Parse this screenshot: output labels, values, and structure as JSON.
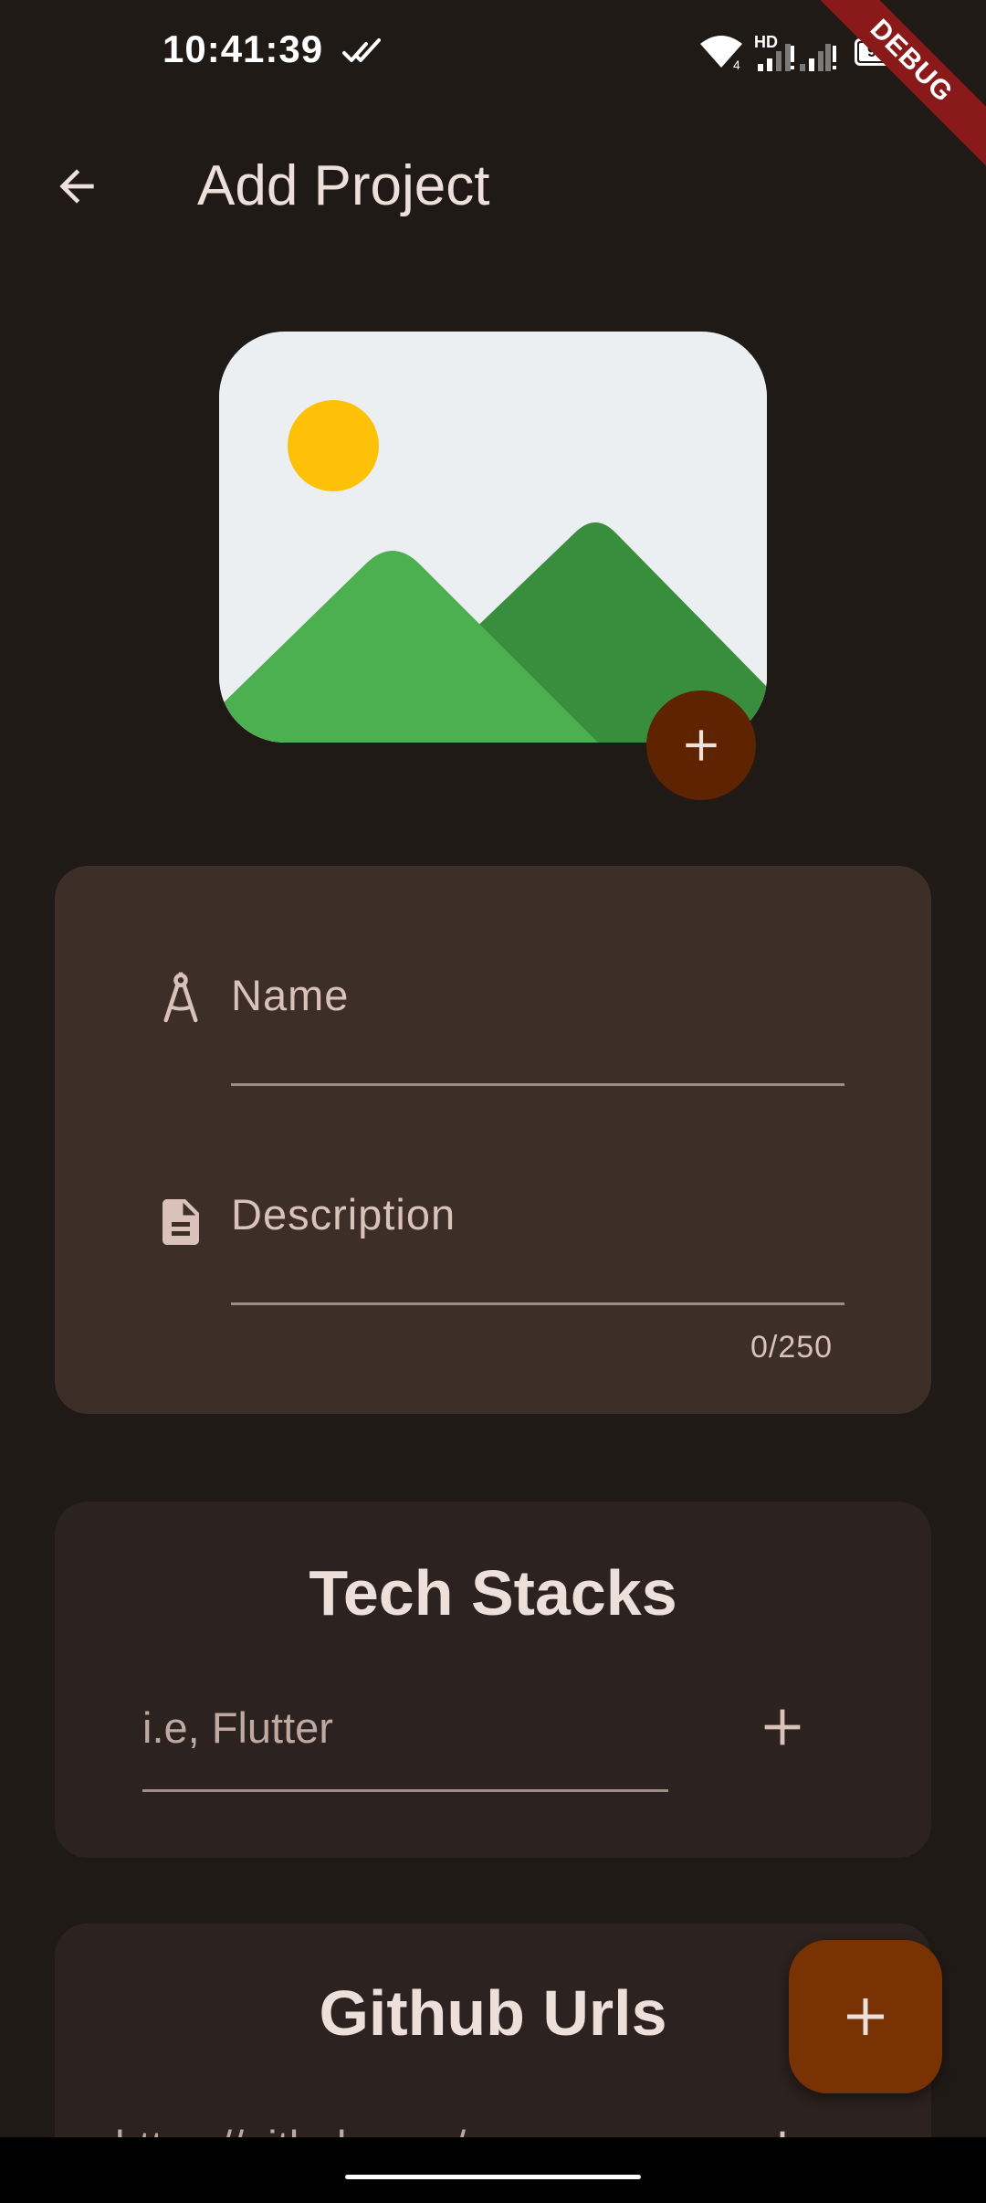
{
  "status_bar": {
    "time": "10:41:39",
    "network_label": "HD",
    "wifi_badge": "4",
    "battery": "92"
  },
  "debug_banner": "DEBUG",
  "app_bar": {
    "title": "Add Project"
  },
  "form": {
    "name_label": "Name",
    "description_label": "Description",
    "description_counter": "0/250"
  },
  "tech_stacks": {
    "title": "Tech Stacks",
    "input_hint": "i.e, Flutter"
  },
  "github_urls": {
    "title": "Github Urls",
    "input_hint": "https://github.com/..."
  },
  "colors": {
    "background": "#201a17",
    "card_primary": "#3d2e28",
    "card_secondary": "#2c221f",
    "accent_fab": "#783204",
    "accent_image_button": "#5e2300",
    "text_primary": "#ede0da",
    "text_secondary": "#d8c2ba"
  },
  "icons": {
    "back": "arrow-left-icon",
    "name_field": "compass-drafting-icon",
    "description_field": "document-icon",
    "add": "plus-icon",
    "image_placeholder": "landscape-image-icon"
  }
}
